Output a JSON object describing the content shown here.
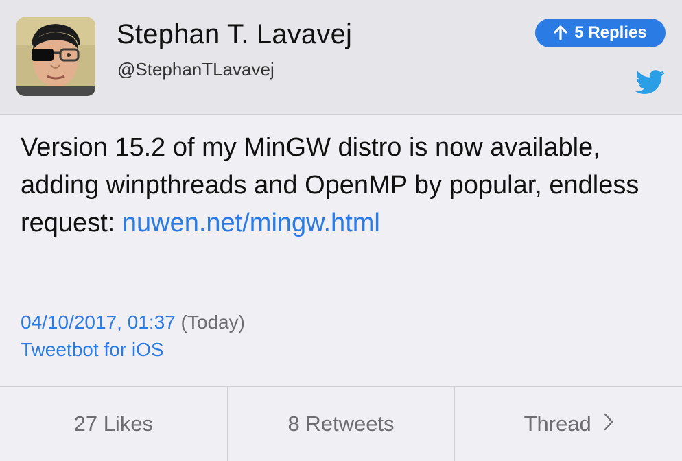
{
  "user": {
    "name": "Stephan T. Lavavej",
    "handle": "@StephanTLavavej"
  },
  "replies_label": "5 Replies",
  "tweet": {
    "text": "Version 15.2 of my MinGW distro is now available, adding winpthreads and OpenMP by popular, endless request: ",
    "link": "nuwen.net/mingw.html"
  },
  "meta": {
    "date": "04/10/2017, 01:37",
    "relative": "(Today)",
    "client": "Tweetbot for iOS"
  },
  "footer": {
    "likes": "27 Likes",
    "retweets": "8 Retweets",
    "thread": "Thread"
  },
  "colors": {
    "accent": "#2b7be5",
    "header_bg": "#e5e5ea",
    "page_bg": "#efeff4",
    "muted": "#6d6d72"
  },
  "icons": {
    "reply_arrow": "arrow-up-icon",
    "twitter_bird": "twitter-bird-icon",
    "thread_chevron": "chevron-right-icon"
  }
}
